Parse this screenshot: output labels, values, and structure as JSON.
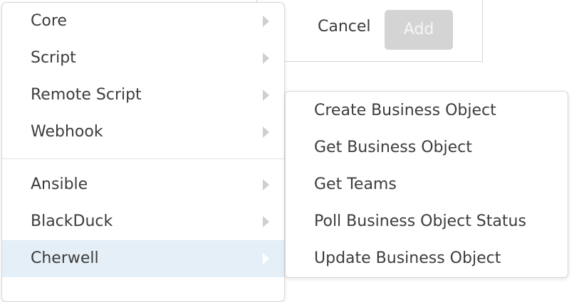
{
  "dialog": {
    "cancel_label": "Cancel",
    "add_label": "Add"
  },
  "menu": {
    "groups": [
      {
        "items": [
          {
            "label": "Core",
            "has_submenu": true
          },
          {
            "label": "Script",
            "has_submenu": true
          },
          {
            "label": "Remote Script",
            "has_submenu": true
          },
          {
            "label": "Webhook",
            "has_submenu": true
          }
        ]
      },
      {
        "items": [
          {
            "label": "Ansible",
            "has_submenu": true
          },
          {
            "label": "BlackDuck",
            "has_submenu": true
          },
          {
            "label": "Cherwell",
            "has_submenu": true,
            "active": true
          }
        ]
      }
    ]
  },
  "submenu": {
    "parent": "Cherwell",
    "items": [
      {
        "label": "Create Business Object"
      },
      {
        "label": "Get Business Object"
      },
      {
        "label": "Get Teams"
      },
      {
        "label": "Poll Business Object Status"
      },
      {
        "label": "Update Business Object"
      }
    ]
  },
  "colors": {
    "active_item_bg": "#e4eff7",
    "disabled_button_bg": "#d4d4d4",
    "text": "#3c3c3c",
    "chevron": "#cfcfcf"
  }
}
